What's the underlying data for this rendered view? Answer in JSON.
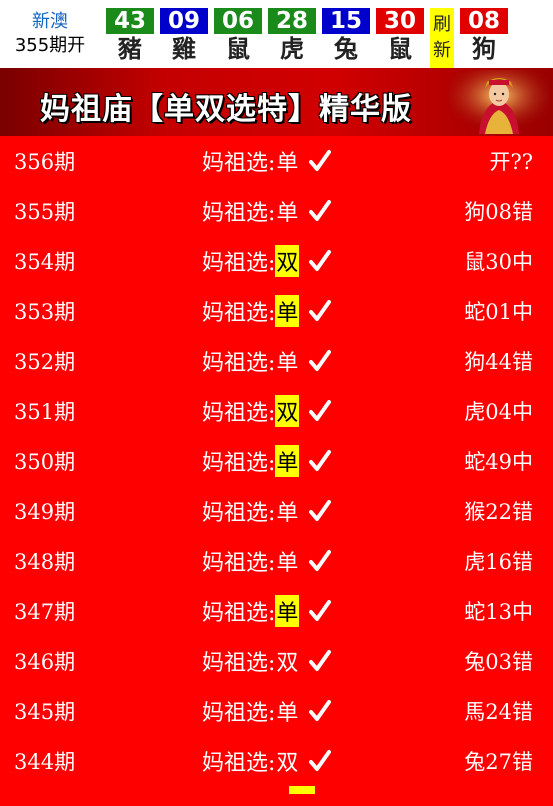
{
  "topbar": {
    "label_line1": "新澳",
    "label_line2": "355期开",
    "balls": [
      {
        "num": "43",
        "zodiac": "豬",
        "color": "#1a8a1a"
      },
      {
        "num": "09",
        "zodiac": "雞",
        "color": "#0000cc"
      },
      {
        "num": "06",
        "zodiac": "鼠",
        "color": "#1a8a1a"
      },
      {
        "num": "28",
        "zodiac": "虎",
        "color": "#1a8a1a"
      },
      {
        "num": "15",
        "zodiac": "兔",
        "color": "#0000cc"
      },
      {
        "num": "30",
        "zodiac": "鼠",
        "color": "#e00000"
      },
      {
        "num": "08",
        "zodiac": "狗",
        "color": "#e00000"
      }
    ],
    "refresh_line1": "刷",
    "refresh_line2": "新"
  },
  "banner": {
    "title": "妈祖庙【单双选特】精华版"
  },
  "rows": [
    {
      "period": "356期",
      "label": "妈祖选:",
      "pick": "单",
      "highlight": false,
      "result": "开??"
    },
    {
      "period": "355期",
      "label": "妈祖选:",
      "pick": "单",
      "highlight": false,
      "result": "狗08错"
    },
    {
      "period": "354期",
      "label": "妈祖选:",
      "pick": "双",
      "highlight": true,
      "result": "鼠30中"
    },
    {
      "period": "353期",
      "label": "妈祖选:",
      "pick": "单",
      "highlight": true,
      "result": "蛇01中"
    },
    {
      "period": "352期",
      "label": "妈祖选:",
      "pick": "单",
      "highlight": false,
      "result": "狗44错"
    },
    {
      "period": "351期",
      "label": "妈祖选:",
      "pick": "双",
      "highlight": true,
      "result": "虎04中"
    },
    {
      "period": "350期",
      "label": "妈祖选:",
      "pick": "单",
      "highlight": true,
      "result": "蛇49中"
    },
    {
      "period": "349期",
      "label": "妈祖选:",
      "pick": "单",
      "highlight": false,
      "result": "猴22错"
    },
    {
      "period": "348期",
      "label": "妈祖选:",
      "pick": "单",
      "highlight": false,
      "result": "虎16错"
    },
    {
      "period": "347期",
      "label": "妈祖选:",
      "pick": "单",
      "highlight": true,
      "result": "蛇13中"
    },
    {
      "period": "346期",
      "label": "妈祖选:",
      "pick": "双",
      "highlight": false,
      "result": "兔03错"
    },
    {
      "period": "345期",
      "label": "妈祖选:",
      "pick": "单",
      "highlight": false,
      "result": "馬24错"
    },
    {
      "period": "344期",
      "label": "妈祖选:",
      "pick": "双",
      "highlight": false,
      "result": "兔27错"
    }
  ]
}
